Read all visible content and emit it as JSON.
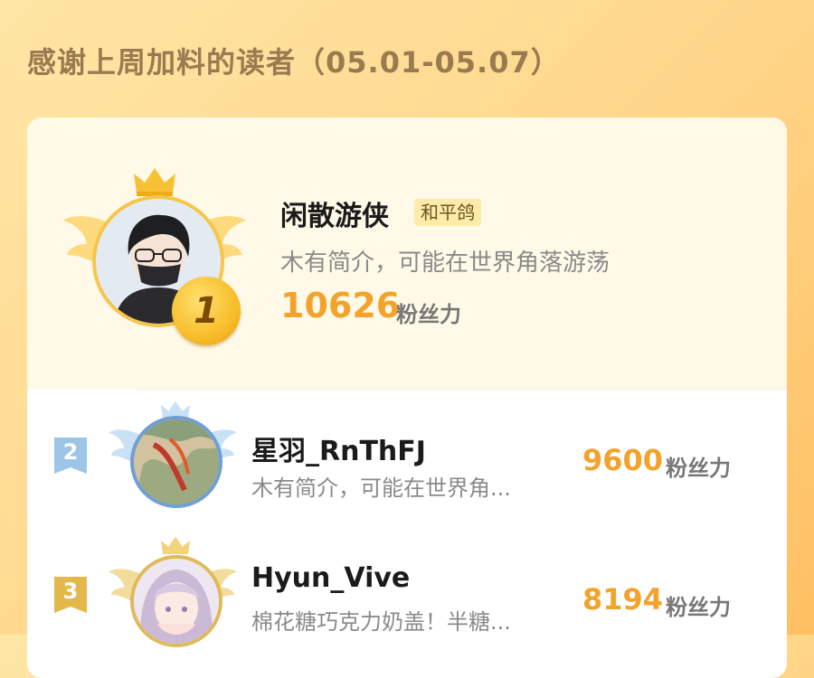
{
  "header": {
    "title": "感谢上周加料的读者（05.01-05.07）"
  },
  "leaderboard": [
    {
      "rank": "1",
      "username": "闲散游侠",
      "title_badge": "和平鸽",
      "bio": "木有简介，可能在世界角落游荡",
      "fans": "10626",
      "fans_unit": "粉丝力"
    },
    {
      "rank": "2",
      "username": "星羽_RnThFJ",
      "bio": "木有简介，可能在世界角...",
      "fans": "9600",
      "fans_unit": "粉丝力"
    },
    {
      "rank": "3",
      "username": "Hyun_Vive",
      "bio": "棉花糖巧克力奶盖！半糖...",
      "fans": "8194",
      "fans_unit": "粉丝力"
    }
  ],
  "colors": {
    "accent": "#f3a32c",
    "rank1": "#f8bd2a",
    "rank2": "#9cc5e8",
    "rank3": "#e3b94e"
  }
}
